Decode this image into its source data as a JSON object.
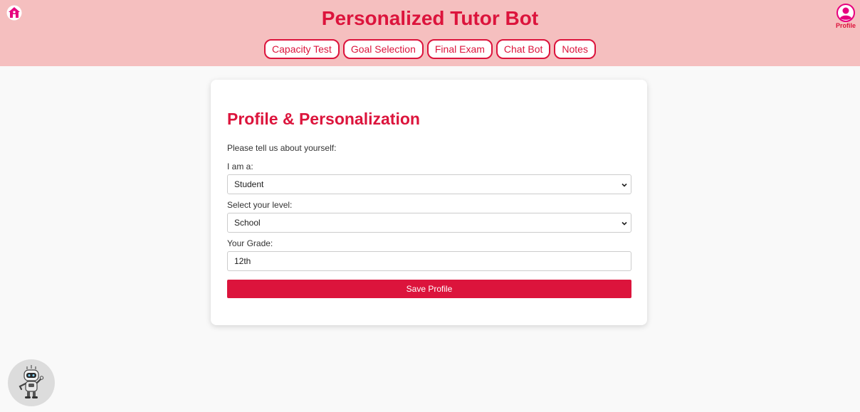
{
  "header": {
    "title": "Personalized Tutor Bot",
    "nav": [
      {
        "label": "Capacity Test"
      },
      {
        "label": "Goal Selection"
      },
      {
        "label": "Final Exam"
      },
      {
        "label": "Chat Bot"
      },
      {
        "label": "Notes"
      }
    ],
    "profile_label": "Profile",
    "home_icon": "home-icon",
    "profile_icon": "user-circle-icon"
  },
  "form": {
    "title": "Profile & Personalization",
    "intro": "Please tell us about yourself:",
    "role_label": "I am a:",
    "role_value": "Student",
    "level_label": "Select your level:",
    "level_value": "School",
    "grade_label": "Your Grade:",
    "grade_value": "12th",
    "save_label": "Save Profile"
  },
  "colors": {
    "accent": "#dc143c",
    "header_bg": "#f5bfbf",
    "page_bg": "#f9f9f9"
  },
  "assistant": {
    "icon": "robot-icon"
  }
}
